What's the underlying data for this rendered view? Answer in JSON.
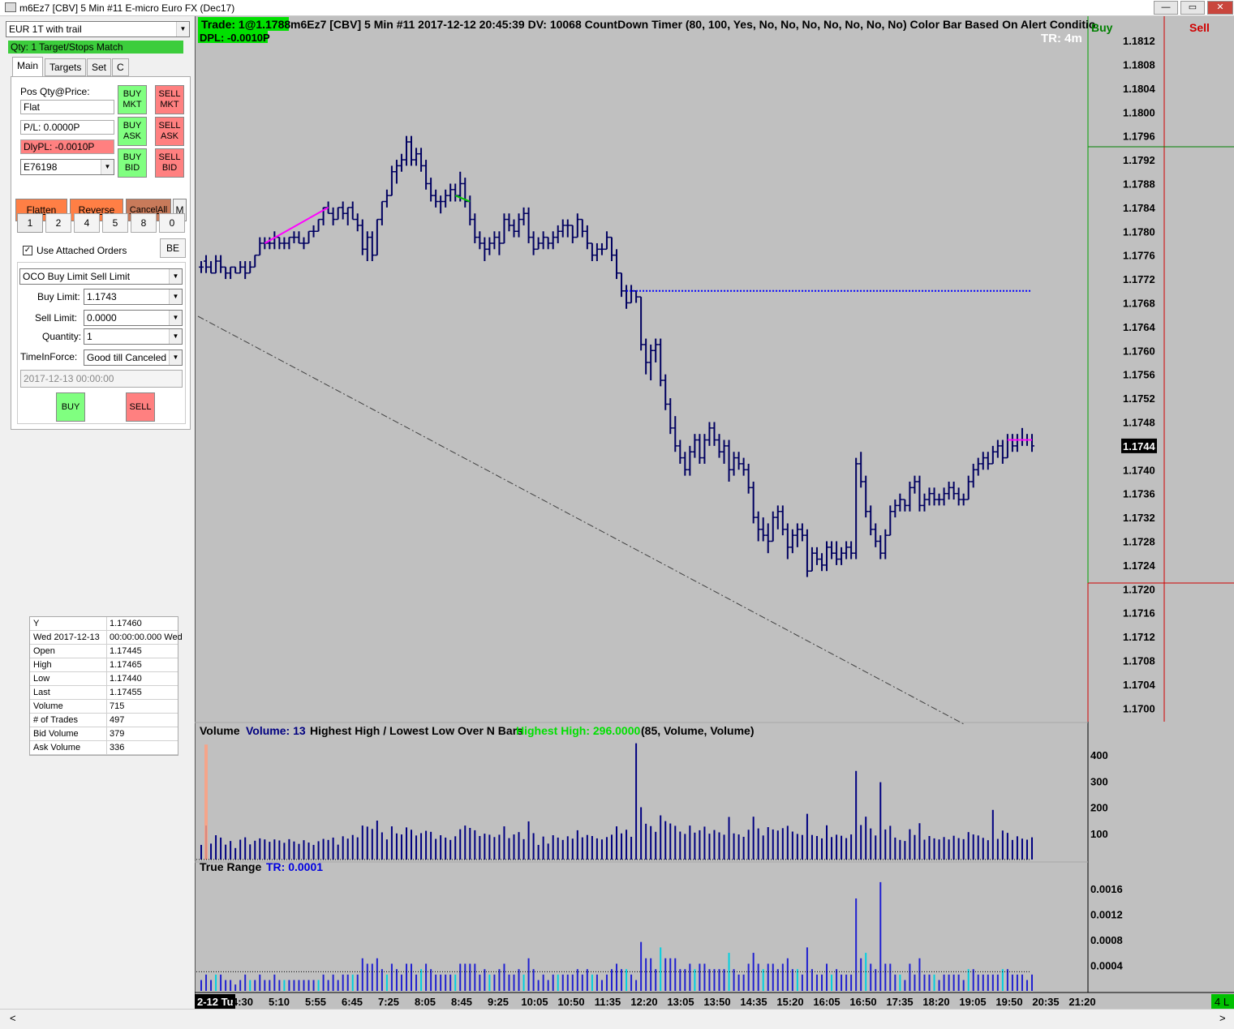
{
  "window": {
    "title": "m6Ez7 [CBV]  5 Min   #11  E-micro Euro FX (Dec17)",
    "minimize_label": "—",
    "maximize_label": "▭",
    "close_label": "✕"
  },
  "order_panel": {
    "strategy": "EUR 1T with trail",
    "qty_status": "Qty: 1 Target/Stops Match",
    "tabs": [
      "Main",
      "Targets",
      "Set",
      "C"
    ],
    "pos_label": "Pos Qty@Price:",
    "pos_value": "Flat",
    "pl_value": "P/L: 0.0000P",
    "dlypl_value": "DlyPL: -0.0010P",
    "account": "E76198",
    "buy_mkt": "BUY MKT",
    "sell_mkt": "SELL MKT",
    "buy_ask": "BUY ASK",
    "sell_ask": "SELL ASK",
    "buy_bid": "BUY BID",
    "sell_bid": "SELL BID",
    "flatten": "Flatten",
    "reverse": "Reverse",
    "cancel_all": "CancelAll",
    "m_label": "M",
    "qty_buttons": [
      "1",
      "2",
      "4",
      "5",
      "8",
      "0"
    ],
    "use_attached": "Use Attached Orders",
    "be_label": "BE",
    "order_type": "OCO Buy Limit Sell Limit",
    "buy_limit_label": "Buy Limit:",
    "buy_limit_value": "1.1743",
    "sell_limit_label": "Sell Limit:",
    "sell_limit_value": "0.0000",
    "quantity_label": "Quantity:",
    "quantity_value": "1",
    "tif_label": "TimeInForce:",
    "tif_value": "Good till Canceled",
    "datetime_value": "2017-12-13  00:00:00",
    "buy": "BUY",
    "sell": "SELL"
  },
  "data_window": [
    [
      "Y",
      "1.17460"
    ],
    [
      "Wed 2017-12-13",
      "00:00:00.000 Wed"
    ],
    [
      "Open",
      "1.17445"
    ],
    [
      "High",
      "1.17465"
    ],
    [
      "Low",
      "1.17440"
    ],
    [
      "Last",
      "1.17455"
    ],
    [
      "Volume",
      "715"
    ],
    [
      "# of Trades",
      "497"
    ],
    [
      "Bid Volume",
      "379"
    ],
    [
      "Ask Volume",
      "336"
    ]
  ],
  "chart": {
    "trade_badge": "Trade: 1@1.1788",
    "header": "m6Ez7 [CBV]  5 Min   #11 2017-12-12 20:45:39 DV: 10068  CountDown Timer   (80, 100, Yes, No, No, No, No, No, No, No)  Color Bar Based On Alert Conditio",
    "dpl_badge": "DPL: -0.0010P",
    "tr_label": "TR: 4m",
    "buy_col": "Buy",
    "sell_col": "Sell",
    "last_price": "1.1744",
    "price_ticks": [
      "1.1812",
      "1.1808",
      "1.1804",
      "1.1800",
      "1.1796",
      "1.1792",
      "1.1788",
      "1.1784",
      "1.1780",
      "1.1776",
      "1.1772",
      "1.1768",
      "1.1764",
      "1.1760",
      "1.1756",
      "1.1752",
      "1.1748",
      "1.1744",
      "1.1740",
      "1.1736",
      "1.1732",
      "1.1728",
      "1.1724",
      "1.1720",
      "1.1716",
      "1.1712",
      "1.1708",
      "1.1704",
      "1.1700"
    ],
    "volume_title": "Volume",
    "volume_value": "Volume: 13",
    "hhll_label": "Highest High / Lowest Low Over N Bars",
    "hh_value": "Highest High: 296.0000",
    "hhll_params": "(85, Volume, Volume)",
    "volume_ticks": [
      "400",
      "300",
      "200",
      "100"
    ],
    "tr_title": "True Range",
    "tr_value": "TR: 0.0001",
    "tr_ticks": [
      "0.0016",
      "0.0012",
      "0.0008",
      "0.0004"
    ],
    "time_ticks": [
      "2-12 Tu",
      "4:30",
      "5:10",
      "5:55",
      "6:45",
      "7:25",
      "8:05",
      "8:45",
      "9:25",
      "10:05",
      "10:50",
      "11:35",
      "12:20",
      "13:05",
      "13:50",
      "14:35",
      "15:20",
      "16:05",
      "16:50",
      "17:35",
      "18:20",
      "19:05",
      "19:50",
      "20:35",
      "21:20"
    ],
    "lot_badge": "4 L",
    "colors": {
      "bar": "#000060",
      "background": "#c0c0c0",
      "volume_up": "#000080",
      "volume_alt": "#ff9f7f",
      "tr_bar": "#2020d0",
      "tr_highlight": "#00d0e0",
      "hh_color": "#00e000",
      "order_line": "#0000ff",
      "magenta": "#ff00ff"
    }
  },
  "chart_data": {
    "type": "candlestick",
    "price_range": [
      1.1698,
      1.1815
    ],
    "order_level": 1.177,
    "bars": [
      [
        1.1774,
        1.1775,
        1.1773,
        1.1774
      ],
      [
        1.1775,
        1.1776,
        1.1773,
        1.1774
      ],
      [
        1.1774,
        1.1775,
        1.1773,
        1.1773
      ],
      [
        1.1773,
        1.1776,
        1.1773,
        1.1775
      ],
      [
        1.1775,
        1.1776,
        1.1773,
        1.1774
      ],
      [
        1.1774,
        1.1774,
        1.1772,
        1.1773
      ],
      [
        1.1773,
        1.1774,
        1.1772,
        1.1774
      ],
      [
        1.1774,
        1.1774,
        1.1773,
        1.1773
      ],
      [
        1.1773,
        1.1775,
        1.1773,
        1.1774
      ],
      [
        1.1774,
        1.1775,
        1.1772,
        1.1773
      ],
      [
        1.1773,
        1.1775,
        1.1773,
        1.1774
      ],
      [
        1.1774,
        1.1776,
        1.1774,
        1.1776
      ],
      [
        1.1776,
        1.1779,
        1.1776,
        1.1778
      ],
      [
        1.1778,
        1.1779,
        1.1777,
        1.1778
      ],
      [
        1.1778,
        1.1779,
        1.1777,
        1.1778
      ],
      [
        1.1778,
        1.178,
        1.1777,
        1.1779
      ],
      [
        1.1779,
        1.1779,
        1.1777,
        1.1778
      ],
      [
        1.1778,
        1.1779,
        1.1777,
        1.1778
      ],
      [
        1.1778,
        1.1779,
        1.1777,
        1.1779
      ],
      [
        1.1779,
        1.178,
        1.1778,
        1.1779
      ],
      [
        1.1779,
        1.178,
        1.1778,
        1.1778
      ],
      [
        1.1778,
        1.1779,
        1.1777,
        1.1778
      ],
      [
        1.1778,
        1.178,
        1.1778,
        1.178
      ],
      [
        1.178,
        1.1781,
        1.1779,
        1.178
      ],
      [
        1.178,
        1.1782,
        1.178,
        1.1782
      ],
      [
        1.1782,
        1.1784,
        1.1781,
        1.1784
      ],
      [
        1.1784,
        1.1785,
        1.1783,
        1.1783
      ],
      [
        1.1783,
        1.1784,
        1.1781,
        1.1782
      ],
      [
        1.1782,
        1.1784,
        1.1782,
        1.1784
      ],
      [
        1.1784,
        1.1785,
        1.1782,
        1.1783
      ],
      [
        1.1783,
        1.1784,
        1.1781,
        1.1784
      ],
      [
        1.1784,
        1.1785,
        1.1782,
        1.1782
      ],
      [
        1.1782,
        1.1783,
        1.178,
        1.1781
      ],
      [
        1.1781,
        1.1782,
        1.1776,
        1.1777
      ],
      [
        1.1777,
        1.178,
        1.1775,
        1.1779
      ],
      [
        1.1779,
        1.178,
        1.1775,
        1.1776
      ],
      [
        1.1776,
        1.1782,
        1.1776,
        1.1782
      ],
      [
        1.1782,
        1.1785,
        1.1781,
        1.1785
      ],
      [
        1.1785,
        1.1787,
        1.1784,
        1.1786
      ],
      [
        1.1786,
        1.1791,
        1.1786,
        1.179
      ],
      [
        1.179,
        1.1792,
        1.1788,
        1.1791
      ],
      [
        1.1791,
        1.1793,
        1.179,
        1.1792
      ],
      [
        1.1792,
        1.1796,
        1.1791,
        1.1795
      ],
      [
        1.1795,
        1.1796,
        1.1791,
        1.1792
      ],
      [
        1.1792,
        1.1794,
        1.1791,
        1.1793
      ],
      [
        1.1793,
        1.1794,
        1.179,
        1.1791
      ],
      [
        1.1791,
        1.1792,
        1.1787,
        1.1788
      ],
      [
        1.1788,
        1.1789,
        1.1785,
        1.1786
      ],
      [
        1.1786,
        1.1787,
        1.1784,
        1.1785
      ],
      [
        1.1785,
        1.1786,
        1.1783,
        1.1785
      ],
      [
        1.1785,
        1.1787,
        1.1784,
        1.1786
      ],
      [
        1.1786,
        1.1788,
        1.1785,
        1.1787
      ],
      [
        1.1787,
        1.1788,
        1.1785,
        1.1786
      ],
      [
        1.1786,
        1.179,
        1.1785,
        1.1788
      ],
      [
        1.1788,
        1.1789,
        1.1784,
        1.1785
      ],
      [
        1.1785,
        1.1786,
        1.1781,
        1.1782
      ],
      [
        1.1782,
        1.1783,
        1.1778,
        1.1779
      ],
      [
        1.1779,
        1.178,
        1.1777,
        1.1778
      ],
      [
        1.1778,
        1.1779,
        1.1775,
        1.1777
      ],
      [
        1.1777,
        1.1779,
        1.1776,
        1.1778
      ],
      [
        1.1778,
        1.178,
        1.1777,
        1.1779
      ],
      [
        1.1779,
        1.178,
        1.1776,
        1.1778
      ],
      [
        1.1778,
        1.1783,
        1.1778,
        1.1782
      ],
      [
        1.1782,
        1.1783,
        1.178,
        1.1781
      ],
      [
        1.1781,
        1.1782,
        1.1779,
        1.178
      ],
      [
        1.178,
        1.1783,
        1.1779,
        1.1782
      ],
      [
        1.1782,
        1.1784,
        1.1781,
        1.1783
      ],
      [
        1.1783,
        1.1784,
        1.1778,
        1.1779
      ],
      [
        1.1779,
        1.178,
        1.1776,
        1.1777
      ],
      [
        1.1777,
        1.1779,
        1.1777,
        1.1778
      ],
      [
        1.1778,
        1.178,
        1.1777,
        1.1779
      ],
      [
        1.1779,
        1.1779,
        1.1777,
        1.1778
      ],
      [
        1.1778,
        1.178,
        1.1777,
        1.1779
      ],
      [
        1.1779,
        1.1781,
        1.1778,
        1.178
      ],
      [
        1.178,
        1.1782,
        1.1779,
        1.1781
      ],
      [
        1.1781,
        1.1782,
        1.1779,
        1.1781
      ],
      [
        1.1781,
        1.1781,
        1.1778,
        1.1779
      ],
      [
        1.1779,
        1.1783,
        1.1779,
        1.1782
      ],
      [
        1.1782,
        1.1782,
        1.1779,
        1.178
      ],
      [
        1.178,
        1.1781,
        1.1777,
        1.1778
      ],
      [
        1.1778,
        1.1778,
        1.1775,
        1.1776
      ],
      [
        1.1776,
        1.1778,
        1.1775,
        1.1777
      ],
      [
        1.1777,
        1.1778,
        1.1776,
        1.1777
      ],
      [
        1.1777,
        1.178,
        1.1777,
        1.1779
      ],
      [
        1.1779,
        1.1779,
        1.1775,
        1.1776
      ],
      [
        1.1776,
        1.1777,
        1.1772,
        1.1773
      ],
      [
        1.1773,
        1.1773,
        1.1769,
        1.177
      ],
      [
        1.177,
        1.1771,
        1.1767,
        1.1768
      ],
      [
        1.1768,
        1.1771,
        1.1768,
        1.177
      ],
      [
        1.177,
        1.177,
        1.1768,
        1.1769
      ],
      [
        1.1769,
        1.1769,
        1.176,
        1.1761
      ],
      [
        1.1761,
        1.1762,
        1.1756,
        1.1758
      ],
      [
        1.1758,
        1.1761,
        1.1755,
        1.176
      ],
      [
        1.176,
        1.1762,
        1.1758,
        1.1761
      ],
      [
        1.1761,
        1.1762,
        1.1754,
        1.1755
      ],
      [
        1.1755,
        1.1756,
        1.175,
        1.1751
      ],
      [
        1.1751,
        1.1752,
        1.1746,
        1.1747
      ],
      [
        1.1747,
        1.1749,
        1.1743,
        1.1744
      ],
      [
        1.1744,
        1.1745,
        1.1741,
        1.1742
      ],
      [
        1.1742,
        1.1743,
        1.1739,
        1.174
      ],
      [
        1.174,
        1.1744,
        1.1739,
        1.1743
      ],
      [
        1.1743,
        1.1746,
        1.1742,
        1.1745
      ],
      [
        1.1745,
        1.1746,
        1.1741,
        1.1742
      ],
      [
        1.1742,
        1.1746,
        1.1741,
        1.1745
      ],
      [
        1.1745,
        1.1748,
        1.1744,
        1.1747
      ],
      [
        1.1747,
        1.1748,
        1.1744,
        1.1745
      ],
      [
        1.1745,
        1.1746,
        1.1742,
        1.1743
      ],
      [
        1.1743,
        1.1745,
        1.1741,
        1.1744
      ],
      [
        1.1744,
        1.1745,
        1.1738,
        1.174
      ],
      [
        1.174,
        1.1743,
        1.1739,
        1.1742
      ],
      [
        1.1742,
        1.1743,
        1.174,
        1.1741
      ],
      [
        1.1741,
        1.1742,
        1.1739,
        1.174
      ],
      [
        1.174,
        1.1741,
        1.1736,
        1.1737
      ],
      [
        1.1737,
        1.1738,
        1.1731,
        1.1732
      ],
      [
        1.1732,
        1.1733,
        1.1728,
        1.173
      ],
      [
        1.173,
        1.1732,
        1.1728,
        1.1729
      ],
      [
        1.1729,
        1.1731,
        1.1726,
        1.1728
      ],
      [
        1.1728,
        1.1733,
        1.1728,
        1.1732
      ],
      [
        1.1732,
        1.1734,
        1.173,
        1.1733
      ],
      [
        1.1733,
        1.1734,
        1.1729,
        1.173
      ],
      [
        1.173,
        1.1731,
        1.1725,
        1.1727
      ],
      [
        1.1727,
        1.173,
        1.1726,
        1.1729
      ],
      [
        1.1729,
        1.1731,
        1.1727,
        1.173
      ],
      [
        1.173,
        1.1731,
        1.1728,
        1.1729
      ],
      [
        1.1729,
        1.173,
        1.1722,
        1.1723
      ],
      [
        1.1723,
        1.1727,
        1.1723,
        1.1726
      ],
      [
        1.1726,
        1.1727,
        1.1724,
        1.1725
      ],
      [
        1.1725,
        1.1726,
        1.1723,
        1.1724
      ],
      [
        1.1724,
        1.1728,
        1.1723,
        1.1727
      ],
      [
        1.1727,
        1.1728,
        1.1725,
        1.1726
      ],
      [
        1.1726,
        1.1728,
        1.1724,
        1.1725
      ],
      [
        1.1725,
        1.1727,
        1.1724,
        1.1726
      ],
      [
        1.1726,
        1.1728,
        1.1725,
        1.1727
      ],
      [
        1.1727,
        1.1728,
        1.1725,
        1.1726
      ],
      [
        1.1726,
        1.1742,
        1.1725,
        1.1741
      ],
      [
        1.1741,
        1.1743,
        1.1737,
        1.1738
      ],
      [
        1.1738,
        1.1739,
        1.1732,
        1.1733
      ],
      [
        1.1733,
        1.1734,
        1.1729,
        1.173
      ],
      [
        1.173,
        1.1731,
        1.1727,
        1.1728
      ],
      [
        1.1728,
        1.1729,
        1.1725,
        1.1726
      ],
      [
        1.1726,
        1.173,
        1.1725,
        1.1729
      ],
      [
        1.1729,
        1.1734,
        1.1729,
        1.1733
      ],
      [
        1.1733,
        1.1735,
        1.1732,
        1.1734
      ],
      [
        1.1734,
        1.1736,
        1.1733,
        1.1735
      ],
      [
        1.1735,
        1.1735,
        1.1733,
        1.1734
      ],
      [
        1.1734,
        1.1738,
        1.1733,
        1.1737
      ],
      [
        1.1737,
        1.1739,
        1.1736,
        1.1738
      ],
      [
        1.1738,
        1.1739,
        1.1733,
        1.1734
      ],
      [
        1.1734,
        1.1736,
        1.1733,
        1.1735
      ],
      [
        1.1735,
        1.1737,
        1.1734,
        1.1736
      ],
      [
        1.1736,
        1.1737,
        1.1734,
        1.1735
      ],
      [
        1.1735,
        1.1736,
        1.1734,
        1.1735
      ],
      [
        1.1735,
        1.1737,
        1.1734,
        1.1736
      ],
      [
        1.1736,
        1.1738,
        1.1735,
        1.1737
      ],
      [
        1.1737,
        1.1738,
        1.1735,
        1.1736
      ],
      [
        1.1736,
        1.1737,
        1.1734,
        1.1735
      ],
      [
        1.1735,
        1.1736,
        1.1734,
        1.1735
      ],
      [
        1.1735,
        1.1739,
        1.1735,
        1.1738
      ],
      [
        1.1738,
        1.1741,
        1.1737,
        1.174
      ],
      [
        1.174,
        1.1742,
        1.1739,
        1.1741
      ],
      [
        1.1741,
        1.1743,
        1.174,
        1.1742
      ],
      [
        1.1742,
        1.1743,
        1.174,
        1.1741
      ],
      [
        1.1741,
        1.1744,
        1.1741,
        1.1743
      ],
      [
        1.1743,
        1.1745,
        1.1742,
        1.1744
      ],
      [
        1.1744,
        1.1745,
        1.1741,
        1.1742
      ],
      [
        1.1742,
        1.1746,
        1.1742,
        1.1745
      ],
      [
        1.1745,
        1.1746,
        1.1743,
        1.1744
      ],
      [
        1.1744,
        1.1746,
        1.1743,
        1.1745
      ],
      [
        1.1745,
        1.1747,
        1.1744,
        1.1745
      ],
      [
        1.1745,
        1.1746,
        1.1744,
        1.1745
      ],
      [
        1.1745,
        1.1746,
        1.1743,
        1.1744
      ]
    ],
    "volume_max": 450,
    "tr_max": 0.0018
  }
}
